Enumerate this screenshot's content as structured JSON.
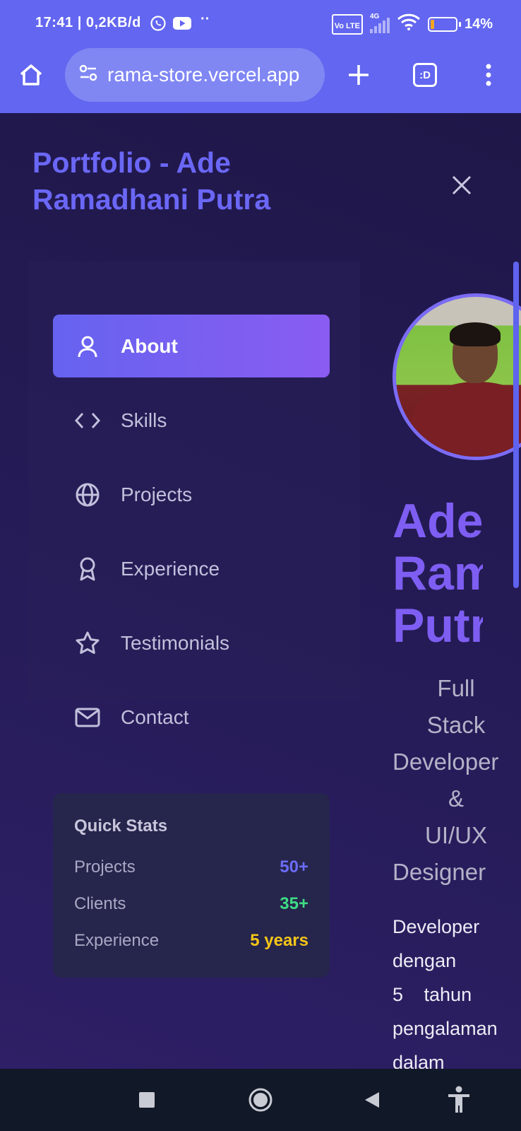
{
  "status_bar": {
    "time": "17:41 | 0,2KB/d",
    "battery_percent": "14%",
    "battery_level": 0.14,
    "network": "4G",
    "volte_label": "Vo LTE"
  },
  "browser": {
    "url": "rama-store.vercel.app",
    "tabs_label": ":D"
  },
  "site": {
    "title": "Portfolio - Ade Ramadhani Putra"
  },
  "nav": {
    "items": [
      {
        "label": "About",
        "icon": "user-icon",
        "active": true
      },
      {
        "label": "Skills",
        "icon": "code-icon",
        "active": false
      },
      {
        "label": "Projects",
        "icon": "globe-icon",
        "active": false
      },
      {
        "label": "Experience",
        "icon": "award-icon",
        "active": false
      },
      {
        "label": "Testimonials",
        "icon": "star-icon",
        "active": false
      },
      {
        "label": "Contact",
        "icon": "mail-icon",
        "active": false
      }
    ]
  },
  "stats": {
    "title": "Quick Stats",
    "rows": [
      {
        "label": "Projects",
        "value": "50+",
        "color": "#6b6cf6"
      },
      {
        "label": "Clients",
        "value": "35+",
        "color": "#3ddc84"
      },
      {
        "label": "Experience",
        "value": "5 years",
        "color": "#f5c518"
      }
    ]
  },
  "hero": {
    "name_lines": [
      "Ade",
      "Ram",
      "Putr"
    ],
    "role_lines": [
      "Full",
      "Stack",
      "Developer",
      "&",
      "UI/UX",
      "Designer"
    ],
    "desc_lines": [
      "Developer",
      "dengan",
      "5 tahun",
      "pengalaman",
      "dalam"
    ]
  },
  "colors": {
    "chrome": "#6266f0",
    "accent": "#6b67f6",
    "background": "#221a4a",
    "nav_bar": "#111827"
  }
}
